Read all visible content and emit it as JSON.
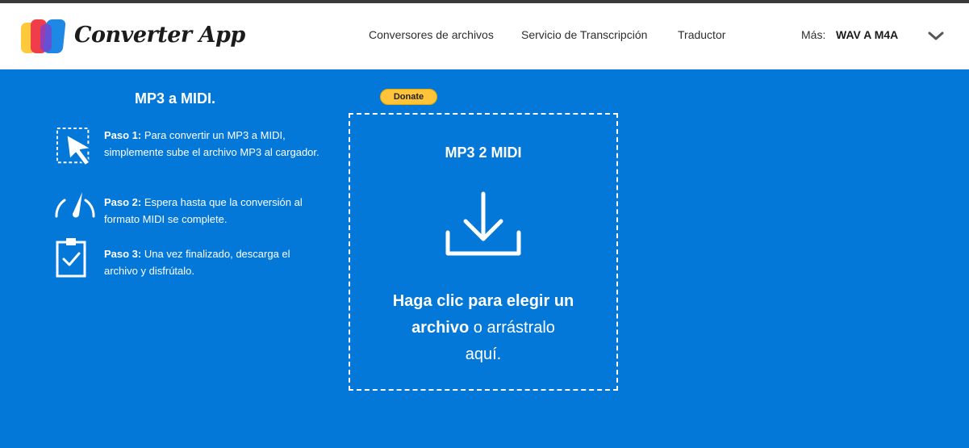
{
  "header": {
    "brand": "Converter App",
    "nav": {
      "files": "Conversores de archivos",
      "transcription": "Servicio de Transcripción",
      "translator": "Traductor"
    },
    "more_label": "Más:",
    "more_value": "WAV A M4A"
  },
  "left": {
    "title": "MP3 a MIDI.",
    "steps": [
      {
        "icon": "cursor-select-icon",
        "label": "Paso 1:",
        "text": " Para convertir un MP3 a MIDI, simplemente sube el archivo MP3 al cargador."
      },
      {
        "icon": "speedometer-icon",
        "label": "Paso 2:",
        "text": " Espera hasta que la conversión al formato MIDI se complete."
      },
      {
        "icon": "clipboard-check-icon",
        "label": "Paso 3:",
        "text": " Una vez finalizado, descarga el archivo y disfrútalo."
      }
    ]
  },
  "donate": {
    "label": "Donate"
  },
  "upload": {
    "title": "MP3 2 MIDI",
    "icon": "download-icon",
    "cta_bold_1": "Haga clic para elegir un",
    "cta_bold_2": "archivo",
    "cta_rest_1": " o arrástralo",
    "cta_rest_2": "aquí."
  },
  "colors": {
    "background": "#0378d8",
    "header": "#ffffff",
    "donate": "#ffc439",
    "logo_red": "#ef3e4a",
    "logo_yellow": "#ffc93c",
    "logo_blue": "#1e88e5"
  }
}
